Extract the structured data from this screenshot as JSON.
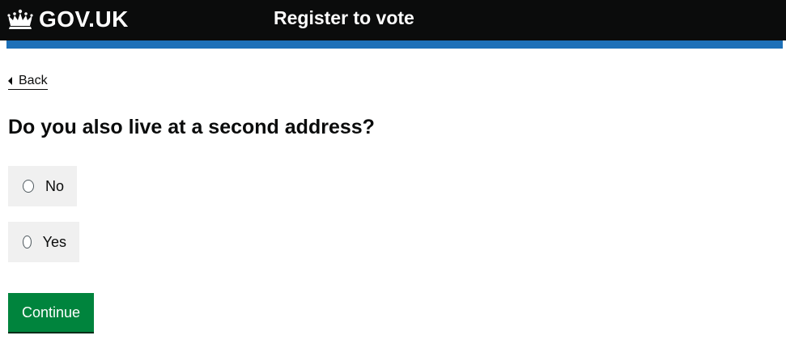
{
  "header": {
    "logo_text": "GOV.UK",
    "logo_icon": "crown-icon",
    "service_name": "Register to vote"
  },
  "colors": {
    "header_bg": "#0b0c0c",
    "accent_bar": "#1d70b8",
    "button_green": "#00843d",
    "option_bg": "#f0f0f0"
  },
  "nav": {
    "back_label": "Back",
    "back_icon": "chevron-left-icon"
  },
  "form": {
    "question": "Do you also live at a second address?",
    "options": [
      {
        "label": "No",
        "selected": false
      },
      {
        "label": "Yes",
        "selected": false
      }
    ],
    "submit_label": "Continue"
  }
}
